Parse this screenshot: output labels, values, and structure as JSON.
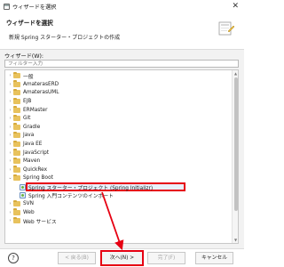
{
  "window": {
    "title": "ウィザードを選択",
    "close_glyph": "✕"
  },
  "header": {
    "title": "ウィザードを選択",
    "description": "新規 Spring スターター・プロジェクトの作成"
  },
  "wizard_label": "ウィザード(W):",
  "filter": {
    "placeholder": "フィルター入力",
    "value": ""
  },
  "tree": {
    "items": [
      {
        "label": "一般",
        "level": 0,
        "expanded": false,
        "icon": "folder-icon"
      },
      {
        "label": "AmaterasERD",
        "level": 0,
        "expanded": false,
        "icon": "folder-icon"
      },
      {
        "label": "AmaterasUML",
        "level": 0,
        "expanded": false,
        "icon": "folder-icon"
      },
      {
        "label": "EJB",
        "level": 0,
        "expanded": false,
        "icon": "folder-icon"
      },
      {
        "label": "ERMaster",
        "level": 0,
        "expanded": false,
        "icon": "folder-icon"
      },
      {
        "label": "Git",
        "level": 0,
        "expanded": false,
        "icon": "folder-icon"
      },
      {
        "label": "Gradle",
        "level": 0,
        "expanded": false,
        "icon": "folder-icon"
      },
      {
        "label": "Java",
        "level": 0,
        "expanded": false,
        "icon": "folder-icon"
      },
      {
        "label": "Java EE",
        "level": 0,
        "expanded": false,
        "icon": "folder-icon"
      },
      {
        "label": "JavaScript",
        "level": 0,
        "expanded": false,
        "icon": "folder-icon"
      },
      {
        "label": "Maven",
        "level": 0,
        "expanded": false,
        "icon": "folder-icon"
      },
      {
        "label": "QuickRex",
        "level": 0,
        "expanded": false,
        "icon": "folder-icon"
      },
      {
        "label": "Spring Boot",
        "level": 0,
        "expanded": true,
        "icon": "folder-icon"
      },
      {
        "label": "Spring スターター・プロジェクト (Spring Initializr)",
        "level": 1,
        "selected": true,
        "icon": "spring-project-icon"
      },
      {
        "label": "Spring 入門コンテンツのインポート",
        "level": 1,
        "icon": "spring-project-icon"
      },
      {
        "label": "SVN",
        "level": 0,
        "expanded": false,
        "icon": "folder-icon"
      },
      {
        "label": "Web",
        "level": 0,
        "expanded": false,
        "icon": "folder-icon"
      },
      {
        "label": "Web サービス",
        "level": 0,
        "expanded": false,
        "icon": "folder-icon"
      }
    ]
  },
  "footer": {
    "help_glyph": "?",
    "back_label": "< 戻る(B)",
    "next_label": "次へ(N) >",
    "finish_label": "完了(F)",
    "cancel_label": "キャンセル"
  },
  "colors": {
    "highlight": "#e60012",
    "folder": "#e8c25d",
    "dialog_bg": "#f2f2f2"
  }
}
